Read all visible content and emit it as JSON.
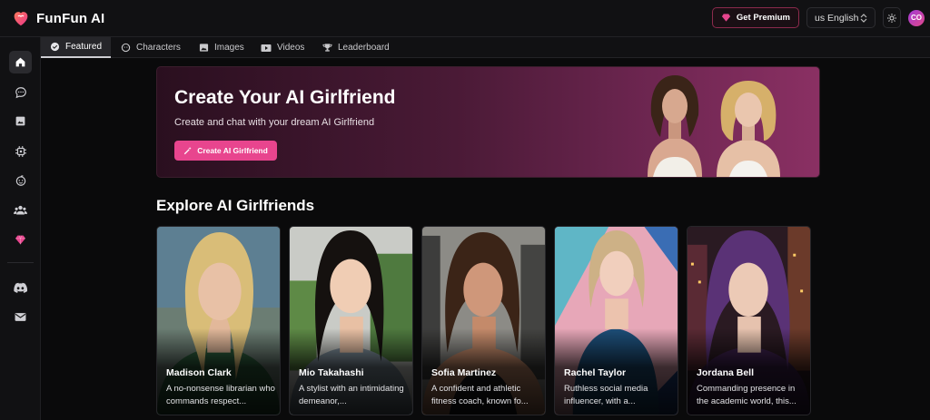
{
  "app": {
    "title": "FunFun AI",
    "brand_color": "#e8458e"
  },
  "header": {
    "premium_label": "Get Premium",
    "language_label": "us English",
    "avatar_initials": "CO"
  },
  "sidebar": {
    "items": [
      {
        "icon": "home-icon"
      },
      {
        "icon": "chat-icon"
      },
      {
        "icon": "image-icon"
      },
      {
        "icon": "chip-icon"
      },
      {
        "icon": "face-icon"
      },
      {
        "icon": "users-icon"
      },
      {
        "icon": "gem-icon"
      },
      {
        "icon": "discord-icon"
      },
      {
        "icon": "mail-icon"
      }
    ]
  },
  "tabs": [
    {
      "label": "Featured",
      "icon": "check-circle-icon",
      "active": true
    },
    {
      "label": "Characters",
      "icon": "face-icon"
    },
    {
      "label": "Images",
      "icon": "image-icon"
    },
    {
      "label": "Videos",
      "icon": "video-icon"
    },
    {
      "label": "Leaderboard",
      "icon": "trophy-icon"
    }
  ],
  "hero": {
    "title": "Create Your AI Girlfriend",
    "subtitle": "Create and chat with your dream AI Girlfriend",
    "button_label": "Create AI Girlfriend"
  },
  "section": {
    "title": "Explore AI Girlfriends"
  },
  "cards": [
    {
      "name": "Madison Clark",
      "desc": "A no-nonsense librarian who commands respect..."
    },
    {
      "name": "Mio Takahashi",
      "desc": "A stylist with an intimidating demeanor,..."
    },
    {
      "name": "Sofia Martinez",
      "desc": "A confident and athletic fitness coach, known fo..."
    },
    {
      "name": "Rachel Taylor",
      "desc": "Ruthless social media influencer, with a..."
    },
    {
      "name": "Jordana Bell",
      "desc": "Commanding presence in the academic world, this..."
    }
  ]
}
